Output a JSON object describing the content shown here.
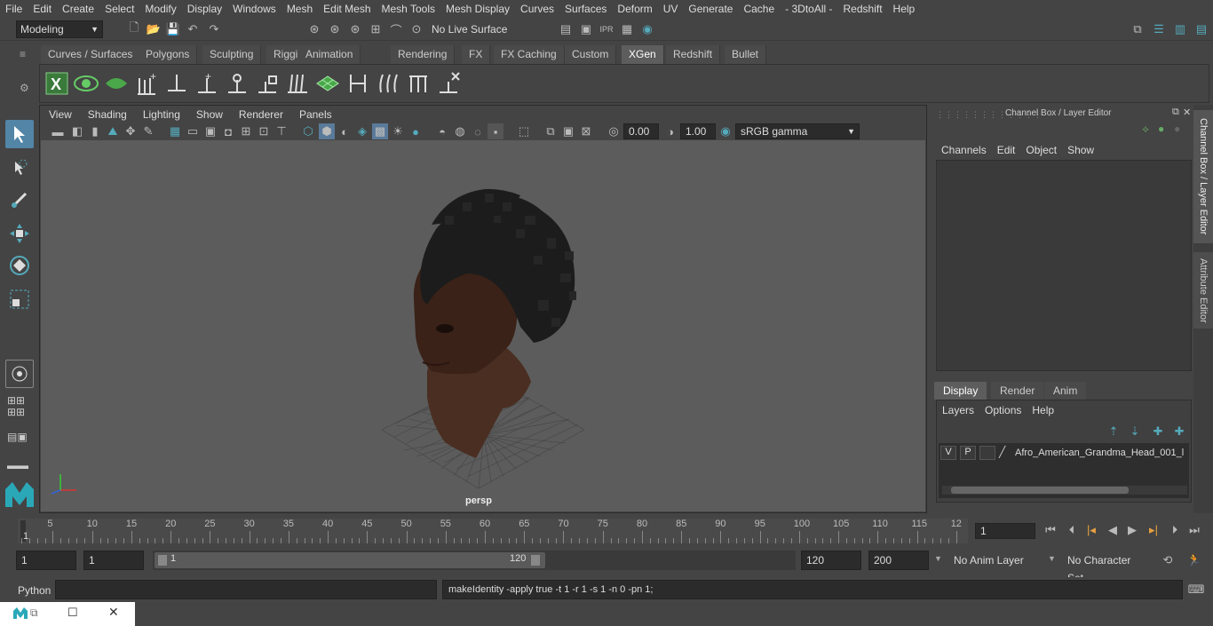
{
  "menubar": [
    "File",
    "Edit",
    "Create",
    "Select",
    "Modify",
    "Display",
    "Windows",
    "Mesh",
    "Edit Mesh",
    "Mesh Tools",
    "Mesh Display",
    "Curves",
    "Surfaces",
    "Deform",
    "UV",
    "Generate",
    "Cache",
    "- 3DtoAll -",
    "Redshift",
    "Help"
  ],
  "status": {
    "mode": "Modeling",
    "live_surface": "No Live Surface"
  },
  "shelf_tabs": [
    "Curves / Surfaces",
    "Polygons",
    "Sculpting",
    "Rigging",
    "Animation",
    "Rendering",
    "FX",
    "FX Caching",
    "Custom",
    "XGen",
    "Redshift",
    "Bullet"
  ],
  "shelf_active": "XGen",
  "panel_menu": [
    "View",
    "Shading",
    "Lighting",
    "Show",
    "Renderer",
    "Panels"
  ],
  "panel_tools": {
    "exposure": "0.00",
    "gamma": "1.00",
    "colorspace": "sRGB gamma"
  },
  "viewport": {
    "camera_label": "persp"
  },
  "channel_box": {
    "title": "Channel Box / Layer Editor",
    "menus": [
      "Channels",
      "Edit",
      "Object",
      "Show"
    ],
    "tabs": [
      "Display",
      "Render",
      "Anim"
    ],
    "active_tab": "Display",
    "layer_menus": [
      "Layers",
      "Options",
      "Help"
    ],
    "layer": {
      "v": "V",
      "p": "P",
      "name": "Afro_American_Grandma_Head_001_l"
    }
  },
  "side_tabs": [
    "Channel Box / Layer Editor",
    "Attribute Editor"
  ],
  "timeline": {
    "ticks": [
      "5",
      "10",
      "15",
      "20",
      "25",
      "30",
      "35",
      "40",
      "45",
      "50",
      "55",
      "60",
      "65",
      "70",
      "75",
      "80",
      "85",
      "90",
      "95",
      "100",
      "105",
      "110",
      "115",
      "12"
    ],
    "start_label": "1",
    "current_frame": "1"
  },
  "range": {
    "start": "1",
    "playback_start": "1",
    "slider_start": "1",
    "slider_end": "120",
    "playback_end": "120",
    "end": "200",
    "anim_layer": "No Anim Layer",
    "char_set": "No Character Set"
  },
  "cmdline": {
    "lang": "Python",
    "feedback": "makeIdentity -apply true -t 1 -r 1 -s 1 -n 0 -pn 1;"
  },
  "colors": {
    "accent": "#5285a6",
    "shelf_active": "#5d5d5d",
    "xgen_green": "#4aa84a",
    "viewport_bg": "#5c5c5c"
  }
}
